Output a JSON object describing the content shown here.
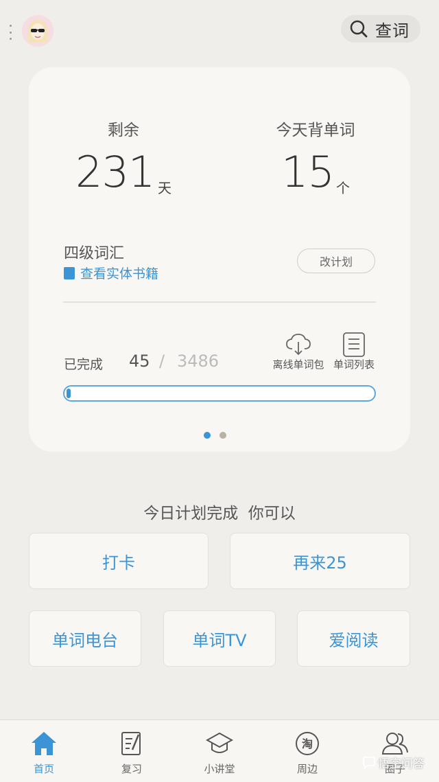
{
  "header": {
    "search_label": "查词"
  },
  "stats": {
    "remaining_label": "剩余",
    "remaining_value": "231",
    "remaining_unit": "天",
    "today_label": "今天背单词",
    "today_value": "15",
    "today_unit": "个"
  },
  "book": {
    "title": "四级词汇",
    "physical_link": "查看实体书籍",
    "change_plan": "改计划"
  },
  "progress": {
    "label": "已完成",
    "done": "45",
    "separator": "/",
    "total": "3486",
    "fraction": 0.0129
  },
  "tools": {
    "offline": "离线单词包",
    "list": "单词列表"
  },
  "pager": {
    "count": 2,
    "active": 0
  },
  "plan": {
    "message": "今日计划完成  你可以",
    "actions_row1": [
      "打卡",
      "再来25"
    ],
    "actions_row2": [
      "单词电台",
      "单词TV",
      "爱阅读"
    ]
  },
  "tabs": [
    {
      "label": "首页",
      "icon": "home-icon",
      "active": true
    },
    {
      "label": "复习",
      "icon": "review-icon",
      "active": false
    },
    {
      "label": "小讲堂",
      "icon": "graduation-cap-icon",
      "active": false
    },
    {
      "label": "周边",
      "icon": "taobao-icon",
      "active": false
    },
    {
      "label": "圈子",
      "icon": "people-icon",
      "active": false
    }
  ],
  "watermark": "悟空问答",
  "colors": {
    "accent": "#3a94d6",
    "background": "#efeeeb",
    "card": "#f8f7f4"
  }
}
